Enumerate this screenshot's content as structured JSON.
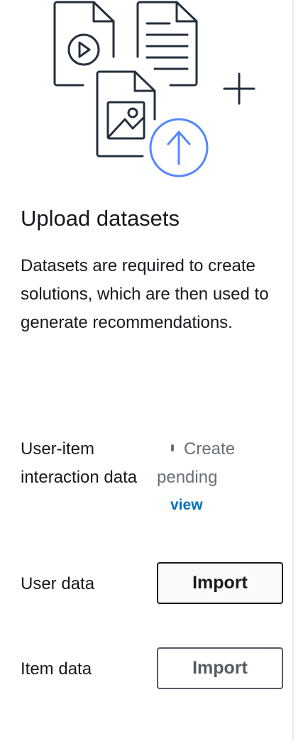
{
  "panel": {
    "title": "Upload datasets",
    "description": "Datasets are required to create solutions, which are then used to generate recommendations.",
    "datasets": [
      {
        "label": "User-item interaction data",
        "status": "Create pending",
        "link": "view"
      },
      {
        "label": "User data",
        "button": "Import"
      },
      {
        "label": "Item data",
        "button": "Import"
      }
    ]
  },
  "colors": {
    "accent": "#5587ff",
    "link": "#0073bb",
    "text": "#16191f",
    "muted": "#687078"
  }
}
